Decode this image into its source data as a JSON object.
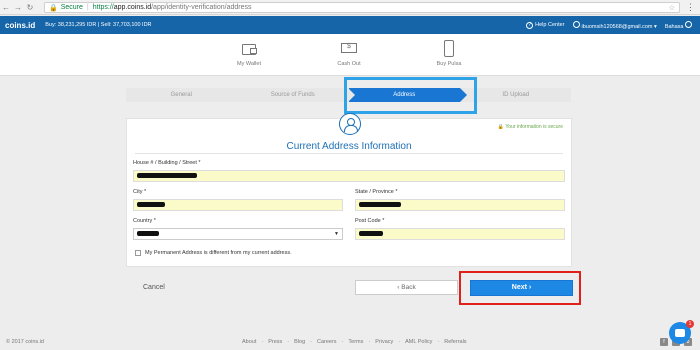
{
  "browser": {
    "secure_label": "Secure",
    "url_https": "https://",
    "url_host": "app.coins.id",
    "url_path": "/app/identity-verification/address"
  },
  "header": {
    "logo": "coins.id",
    "prices": "Buy: 38,231,295 IDR | Sell: 37,703,100 IDR",
    "help": "Help Center",
    "email": "ibuomsih120568@gmail.com ▾",
    "language": "Bahasa"
  },
  "tools": [
    {
      "label": "My Wallet",
      "icon": "wallet-icon"
    },
    {
      "label": "Cash Out",
      "icon": "cash-icon"
    },
    {
      "label": "Buy Pulsa",
      "icon": "phone-icon"
    }
  ],
  "steps": [
    {
      "label": "General"
    },
    {
      "label": "Source of Funds"
    },
    {
      "label": "Address"
    },
    {
      "label": "ID Upload"
    }
  ],
  "form": {
    "secure_note": "🔒 Your information is secure",
    "title": "Current Address Information",
    "street_label": "House # / Building / Street *",
    "city_label": "City *",
    "state_label": "State / Province *",
    "country_label": "Country *",
    "postcode_label": "Post Code *",
    "permanent_label": "My Permanent Address is different from my current address."
  },
  "actions": {
    "cancel": "Cancel",
    "back": "‹ Back",
    "next": "Next ›"
  },
  "footer": {
    "copyright": "© 2017 coins.id",
    "links": [
      "About",
      "·",
      "Press",
      "·",
      "Blog",
      "·",
      "Careers",
      "·",
      "Terms",
      "·",
      "Privacy",
      "·",
      "AML Policy",
      "·",
      "Referrals"
    ]
  },
  "chat": {
    "badge": "1"
  },
  "colors": {
    "brand": "#1565a8",
    "accent": "#1e88e5",
    "highlight_blue": "#2ea3e8",
    "highlight_red": "#e0201b",
    "input_fill": "#fbfbc9"
  }
}
